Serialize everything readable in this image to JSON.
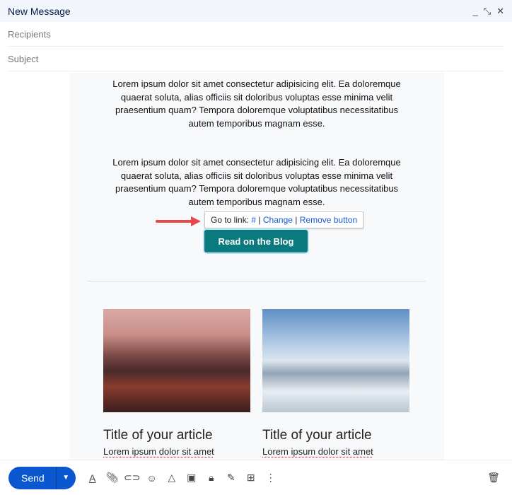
{
  "window": {
    "title": "New Message"
  },
  "fields": {
    "recipients_placeholder": "Recipients",
    "subject_placeholder": "Subject"
  },
  "content": {
    "paragraph1": [
      "Lorem ipsum dolor sit amet consectetur adipisicing elit. Ea doloremque quaerat soluta, alias officiis sit doloribus voluptas esse minima velit praesentium quam? Tempora doloremque voluptatibus necessitatibus autem temporibus magnam esse."
    ],
    "paragraph2": "Lorem ipsum dolor sit amet consectetur adipisicing elit. Ea doloremque quaerat soluta, alias officiis sit doloribus voluptas esse minima velit praesentium quam? Tempora doloremque voluptatibus necessitatibus autem temporibus magnam esse.",
    "link_tooltip": {
      "go_to": "Go to link:",
      "link": "#",
      "sep": "|",
      "change": "Change",
      "remove": "Remove button"
    },
    "cta_label": "Read on the Blog",
    "cards": [
      {
        "title": "Title of your article",
        "text": "Lorem ipsum dolor sit amet"
      },
      {
        "title": "Title of your article",
        "text": "Lorem ipsum dolor sit amet"
      }
    ]
  },
  "toolbar": {
    "send": "Send",
    "send_color": "#0b57d0"
  },
  "colors": {
    "cta": "#0b7a7e",
    "arrow": "#e5484d"
  }
}
